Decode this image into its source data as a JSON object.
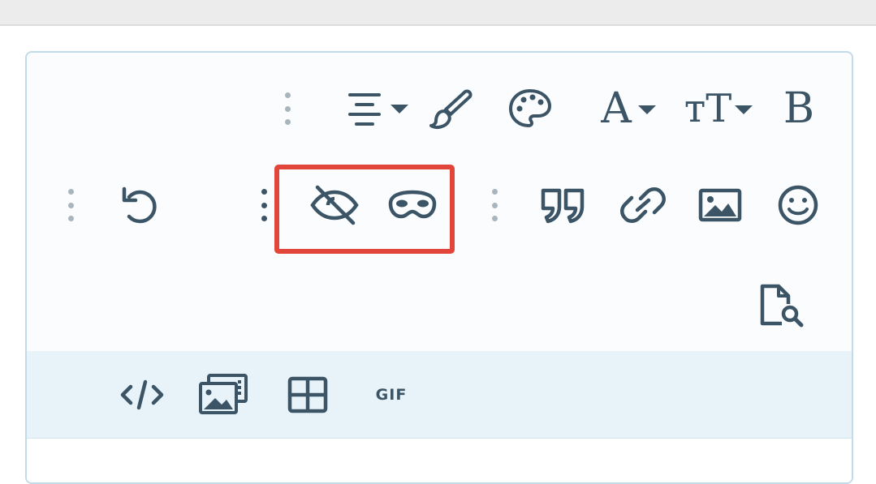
{
  "toolbar": {
    "row1": {
      "align_icon": "align-center-icon",
      "paint_icon": "paint-brush-icon",
      "palette_icon": "palette-icon",
      "font_color_label": "A",
      "font_size_label": "тT",
      "bold_label": "B"
    },
    "row2": {
      "undo_icon": "undo-icon",
      "hide_icon": "eye-slash-icon",
      "spoiler_icon": "mask-icon",
      "quote_icon": "quote-icon",
      "link_icon": "link-icon",
      "image_icon": "image-icon",
      "emoji_icon": "smiley-icon"
    },
    "row3": {
      "preview_icon": "file-search-icon"
    },
    "row4": {
      "code_icon": "code-icon",
      "media_icon": "media-gallery-icon",
      "table_icon": "table-icon",
      "gif_label": "GIF"
    }
  },
  "colors": {
    "icon": "#3c5566",
    "highlight": "#e2463a",
    "border": "#c3dbe8",
    "lower_bar": "#e7f2f9"
  }
}
